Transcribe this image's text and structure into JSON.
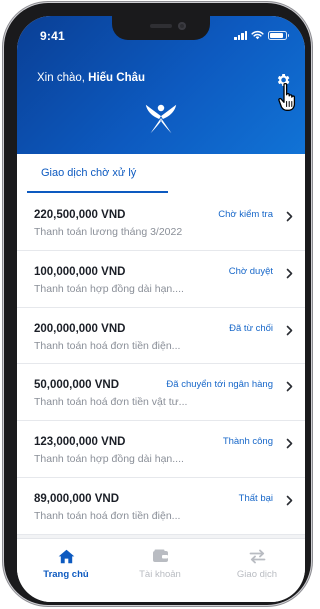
{
  "status_bar": {
    "time": "9:41"
  },
  "header": {
    "greeting_prefix": "Xin chào,",
    "user_name": "Hiếu Châu",
    "icons": {
      "settings": "gear-icon",
      "cursor": "hand-pointer-icon",
      "logo": "brand-logo"
    }
  },
  "tabs": {
    "pending_label": "Giao dịch chờ xử lý"
  },
  "transactions": [
    {
      "amount": "220,500,000 VND",
      "description": "Thanh toán lương tháng 3/2022",
      "status": "Chờ kiểm tra"
    },
    {
      "amount": "100,000,000 VND",
      "description": "Thanh toán hợp đồng dài hạn....",
      "status": "Chờ duyệt"
    },
    {
      "amount": "200,000,000 VND",
      "description": "Thanh toán hoá đơn tiền điện...",
      "status": "Đã từ chối"
    },
    {
      "amount": "50,000,000 VND",
      "description": "Thanh toán hoá đơn tiền vật tư...",
      "status": "Đã chuyển tới ngân hàng"
    },
    {
      "amount": "123,000,000 VND",
      "description": "Thanh toán hợp đồng dài hạn....",
      "status": "Thành công"
    },
    {
      "amount": "89,000,000 VND",
      "description": "Thanh toán hoá đơn tiền điện...",
      "status": "Thất bại"
    }
  ],
  "bottom_nav": {
    "home": "Trang chủ",
    "account": "Tài khoản",
    "transactions": "Giao dịch"
  },
  "colors": {
    "primary": "#0d5ac0",
    "header_dark": "#0a3f95",
    "inactive": "#b9bcc2"
  }
}
